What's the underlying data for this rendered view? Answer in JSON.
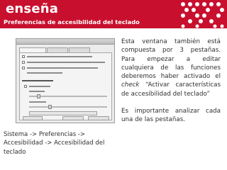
{
  "header": {
    "brand": "enseña",
    "subtitle": "Preferencias de accesibilidad del teclado",
    "background_color": "#c8102e",
    "logo_icon": "dot-grid-logo"
  },
  "screenshot_thumbnail": {
    "description_icon": "keyboard-accessibility-preferences-window-thumbnail"
  },
  "main": {
    "paragraph1_before": "Esta ventana también está compuesta por 3 pestañas. Para empezar a editar cualquiera de las funciones deberemos haber activado el",
    "paragraph1_italic": "check",
    "paragraph1_after": "“Activar características de accesibilidad del teclado”",
    "paragraph2": "Es importante analizar cada una de las pestañas."
  },
  "footer": {
    "menu_path": "Sistema -> Preferencias -> Accesibilidad -> Accesibilidad del teclado"
  }
}
